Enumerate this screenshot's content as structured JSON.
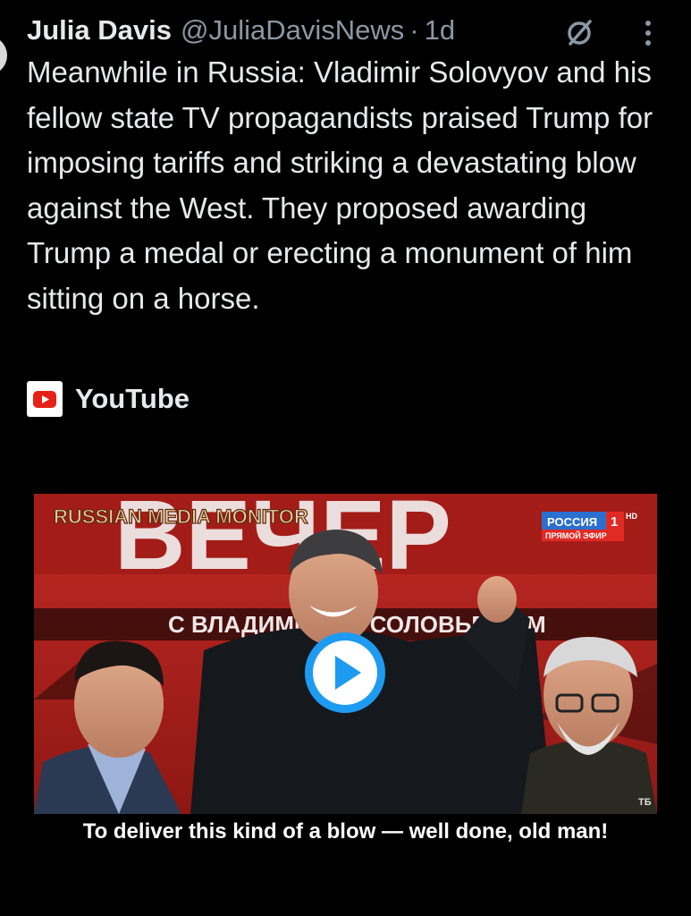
{
  "post": {
    "author": "Julia Davis",
    "handle": "@JuliaDavisNews",
    "separator": "·",
    "time": "1d",
    "text": "Meanwhile in Russia: Vladimir Solovyov and his fellow state TV propagandists praised Trump for imposing tariffs and striking a devastating blow against the West. They proposed awarding Trump a medal or erecting a monument of him sitting on a horse."
  },
  "link": {
    "source": "YouTube"
  },
  "video": {
    "watermark": "RUSSIAN MEDIA MONITOR",
    "channel": "РОССИЯ",
    "channel_number": "1",
    "hd": "HD",
    "live": "ПРЯМОЙ ЭФИР",
    "backdrop": "ВЕЧЕР",
    "lower_bar": "С ВЛАДИМИРОМ СОЛОВЬЕВЫМ",
    "corner_mark": "ТБ",
    "subtitle": "To deliver this kind of a blow — well done, old man!"
  },
  "colors": {
    "background": "#000000",
    "text": "#e7e9ea",
    "muted": "#8b98a5",
    "play": "#1d9bf0",
    "studio_red": "#b8231f"
  },
  "icons": [
    "grok-icon",
    "more-icon",
    "youtube-icon",
    "play-icon"
  ]
}
